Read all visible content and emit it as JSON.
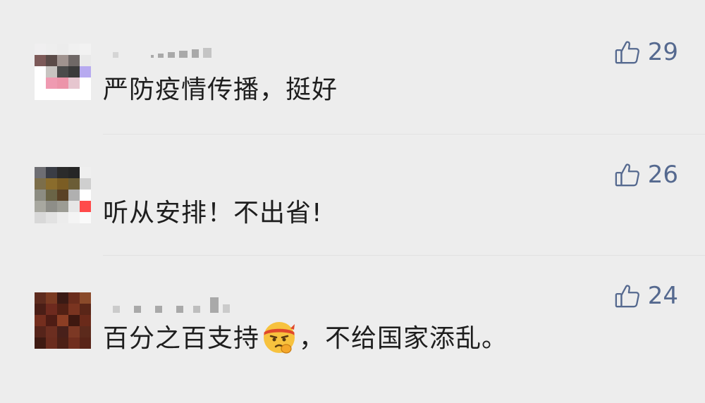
{
  "comments": [
    {
      "text": "严防疫情传播，挺好",
      "likes": "29",
      "avatar_colors": [
        "#f0eff0",
        "#eeeeee",
        "#ececec",
        "#f0f0f0",
        "#f2f2f2",
        "#7d5a59",
        "#5b4b48",
        "#a0938f",
        "#6f6866",
        "#e9e9e9",
        "#ffffff",
        "#c8c4c1",
        "#4b4b4b",
        "#3a3a3a",
        "#b7aaf0",
        "#ffffff",
        "#ef9ab1",
        "#ec94a9",
        "#e6c6cf",
        "#ffffff",
        "#ffffff",
        "#ffffff",
        "#ffffff",
        "#ffffff",
        "#ffffff"
      ]
    },
    {
      "text": "听从安排！不出省!",
      "likes": "26",
      "avatar_colors": [
        "#6e6e73",
        "#3a3d45",
        "#2b2b2b",
        "#262626",
        "#efefef",
        "#7c6e4a",
        "#8a6c2c",
        "#7b5d24",
        "#6b5d36",
        "#cfcfcf",
        "#8c8c82",
        "#6a6446",
        "#5a4226",
        "#b0b0b0",
        "#ffffff",
        "#a8a8a0",
        "#8e8e88",
        "#9c9c94",
        "#e6e6e6",
        "#ff4a4a",
        "#d8d8d8",
        "#e2e2e2",
        "#ececec",
        "#f4f4f4",
        "#fafafa"
      ]
    },
    {
      "text_before": "百分之百支持",
      "text_after": "，不给国家添乱。",
      "emoji_name": "face-with-headband-emoji",
      "likes": "24",
      "avatar_colors": [
        "#5e2b1e",
        "#7a3a22",
        "#3a1a14",
        "#6a2c1c",
        "#8a4a2a",
        "#4a1e16",
        "#6e2a1e",
        "#522014",
        "#7a3420",
        "#5a2618",
        "#742e1e",
        "#4e1c14",
        "#8c3e24",
        "#3e1810",
        "#6a2a1a",
        "#56241a",
        "#6c2e20",
        "#48201a",
        "#7c3824",
        "#5c2a1c",
        "#3e1a12",
        "#6a2c1e",
        "#4c2016",
        "#702e1e",
        "#582418"
      ]
    }
  ],
  "icons": {
    "like": "thumbs-up-outline-icon"
  },
  "colors": {
    "background": "#ededed",
    "text": "#1e1e1e",
    "like_accent": "#55698f"
  }
}
